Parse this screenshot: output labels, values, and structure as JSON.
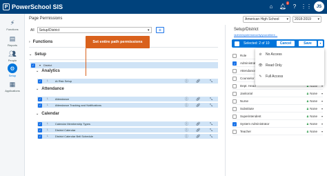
{
  "app": {
    "title": "PowerSchool SIS",
    "logo_letter": "P"
  },
  "topbar": {
    "notification_count": "2",
    "avatar_initials": "JS"
  },
  "nav": [
    {
      "label": "Functions",
      "icon": "functions-icon"
    },
    {
      "label": "Reports",
      "icon": "reports-icon"
    },
    {
      "label": "People",
      "icon": "people-icon"
    },
    {
      "label": "Setup",
      "icon": "gear-icon",
      "active": true
    },
    {
      "label": "Applications",
      "icon": "applications-icon"
    }
  ],
  "header": {
    "page_title": "Page Permissions",
    "school": "American High School",
    "year": "2018-2019"
  },
  "filter": {
    "all_label": "All",
    "path_value": "Setup/District"
  },
  "tree": {
    "functions_label": "Functions",
    "setup_label": "Setup",
    "district_label": "District",
    "analytics_label": "Analytics",
    "attendance_label": "Attendance",
    "calendar_label": "Calendar",
    "analytics_rows": [
      "At Risk Setup"
    ],
    "attendance_rows": [
      "Attendance",
      "Attendance Tracking and Notifications"
    ],
    "calendar_rows": [
      "Calendar Membership Types",
      "District Calendar",
      "District Calendar Bell Schedule"
    ]
  },
  "callout": {
    "text": "Set entire path permissions"
  },
  "right_panel": {
    "title": "Setup/District",
    "path": "/admin/systemsecurity/yourathere...",
    "selection_label": "Selected: 2 of 10",
    "cancel_label": "Cancel",
    "save_label": "Save",
    "roles": [
      {
        "name": "Role",
        "checked": false,
        "perm": ""
      },
      {
        "name": "Administrator",
        "checked": true,
        "perm": ""
      },
      {
        "name": "Attendance",
        "checked": false,
        "perm": ""
      },
      {
        "name": "Counselor",
        "checked": false,
        "perm": ""
      },
      {
        "name": "Dept. Head",
        "checked": false,
        "perm": "None"
      },
      {
        "name": "Janitorial",
        "checked": false,
        "perm": "None"
      },
      {
        "name": "Nurse",
        "checked": false,
        "perm": "None"
      },
      {
        "name": "Substitute",
        "checked": false,
        "perm": "None"
      },
      {
        "name": "Superintendent",
        "checked": false,
        "perm": "None"
      },
      {
        "name": "System Administrator",
        "checked": true,
        "perm": "None"
      },
      {
        "name": "Teacher",
        "checked": false,
        "perm": "None"
      }
    ]
  },
  "menu": {
    "no_access": "No Access",
    "read_only": "Read Only",
    "full_access": "Full Access"
  }
}
